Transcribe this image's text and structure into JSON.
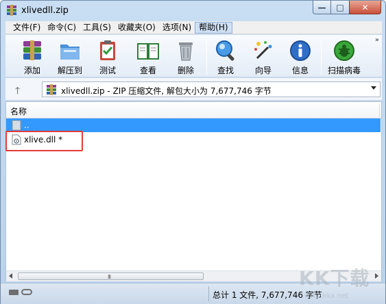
{
  "window": {
    "title": "xlivedll.zip"
  },
  "window_controls": {
    "minimize": "—",
    "maximize": "□",
    "close": "✕"
  },
  "menu": {
    "items": [
      {
        "label": "文件(F)"
      },
      {
        "label": "命令(C)"
      },
      {
        "label": "工具(S)"
      },
      {
        "label": "收藏夹(O)"
      },
      {
        "label": "选项(N)"
      },
      {
        "label": "帮助(H)"
      }
    ]
  },
  "toolbar": {
    "add": "添加",
    "extract": "解压到",
    "test": "测试",
    "view": "查看",
    "delete": "删除",
    "find": "查找",
    "wizard": "向导",
    "info": "信息",
    "virus_scan": "扫描病毒",
    "more": "»"
  },
  "address": {
    "up": "🡑",
    "text": "xlivedll.zip - ZIP 压缩文件, 解包大小为 7,677,746 字节"
  },
  "filelist": {
    "column_name": "名称",
    "rows": [
      {
        "name": ".."
      },
      {
        "name": "xlive.dll *"
      }
    ]
  },
  "scrollbar": {
    "grip": "III"
  },
  "status": {
    "text": "总计 1 文件, 7,677,746 字节"
  },
  "watermark": {
    "text": "KK下载",
    "url": "www.kkx.net"
  },
  "colors": {
    "selection": "#3399ff",
    "highlight_box": "#e6393a"
  }
}
